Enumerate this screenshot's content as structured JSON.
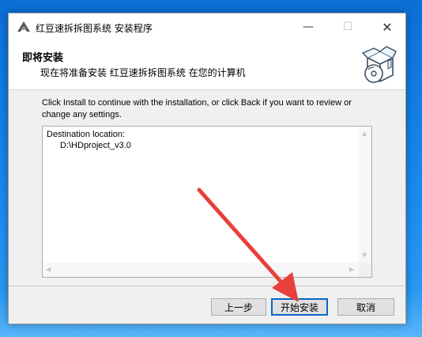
{
  "window": {
    "title": "红豆速拆拆图系统 安装程序",
    "controls": {
      "minimize": "—",
      "maximize": "☐",
      "close": "✕"
    }
  },
  "header": {
    "title": "即将安装",
    "subtitle": "现在将准备安装 红豆速拆拆图系统 在您的计算机"
  },
  "body": {
    "instruction": "Click Install to continue with the installation, or click Back if you want to review or change any settings.",
    "destination_label": "Destination location:",
    "destination_path": "D:\\HDproject_v3.0"
  },
  "buttons": {
    "back": "上一步",
    "install": "开始安装",
    "cancel": "取消"
  },
  "colors": {
    "annotation_arrow": "#e8403a",
    "default_button_border": "#0a64c8"
  },
  "icons": {
    "app": "app-logo-icon",
    "header": "installer-box-cd-icon"
  }
}
